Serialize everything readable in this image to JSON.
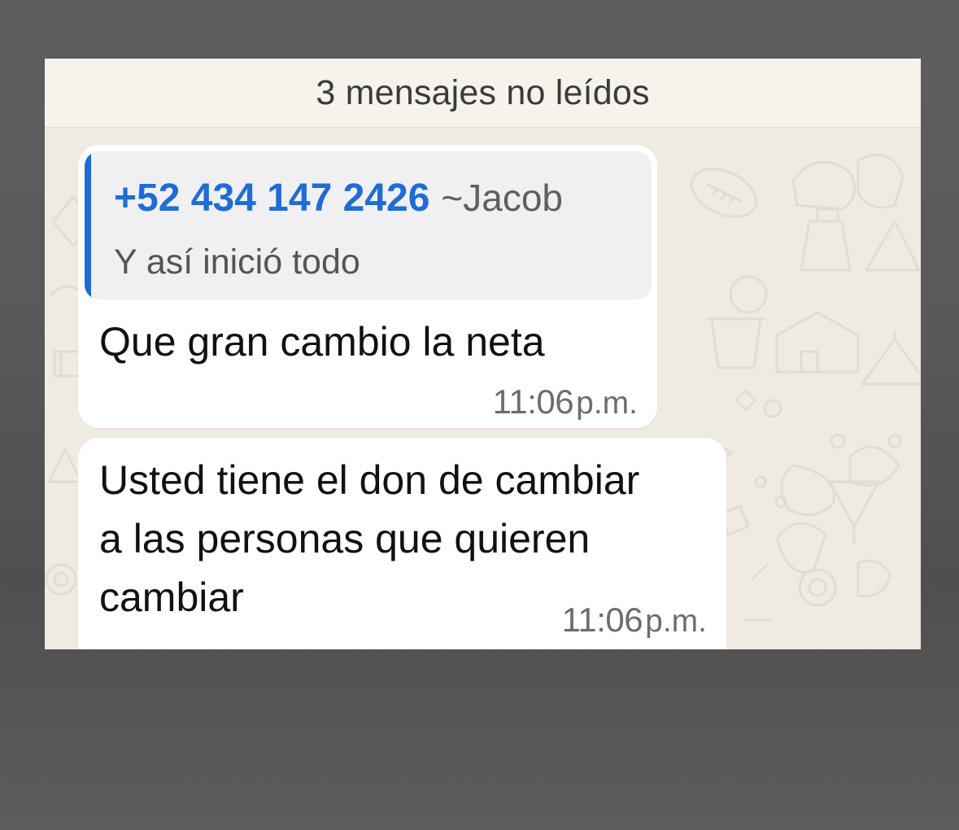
{
  "banner": {
    "unread_label": "3 mensajes no leídos"
  },
  "messages": [
    {
      "reply": {
        "author_phone": "+52 434 147 2426",
        "author_name": "~Jacob",
        "text": "Y así inició todo",
        "accent_color": "#1f6cd6"
      },
      "text_lines": [
        "Que gran cambio la neta"
      ],
      "time": "11:06",
      "time_suffix": "p.m."
    },
    {
      "text_lines": [
        "Usted tiene el don de cambiar",
        "a las personas que quieren",
        "cambiar"
      ],
      "time": "11:06",
      "time_suffix": "p.m."
    }
  ],
  "colors": {
    "chat_background": "#efeae2",
    "bubble": "#ffffff",
    "reply_accent": "#1f6cd6"
  },
  "icons": [
    "doodle-wallpaper"
  ]
}
